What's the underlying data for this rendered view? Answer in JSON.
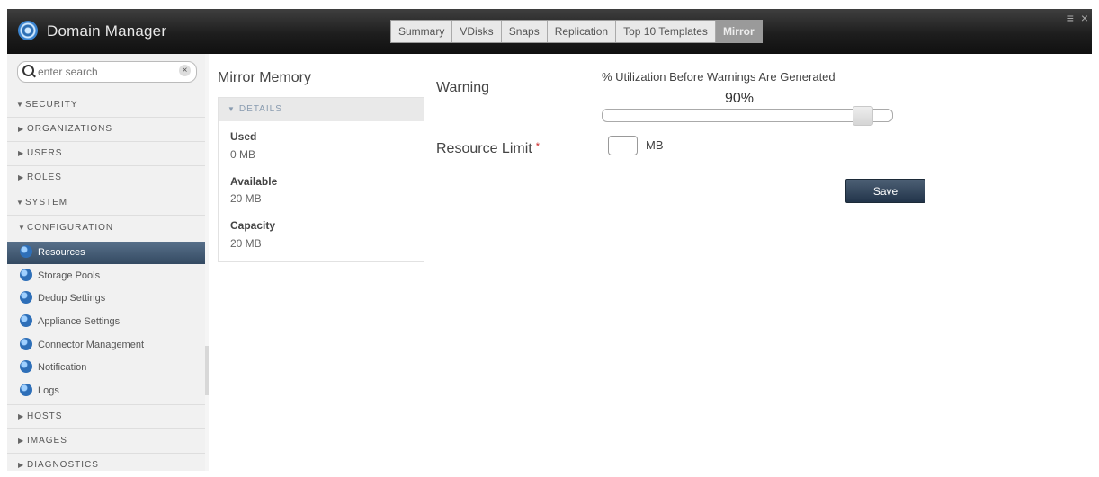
{
  "app": {
    "title": "Domain Manager"
  },
  "tabs": [
    {
      "label": "Summary"
    },
    {
      "label": "VDisks"
    },
    {
      "label": "Snaps"
    },
    {
      "label": "Replication"
    },
    {
      "label": "Top 10 Templates"
    },
    {
      "label": "Mirror",
      "active": true
    }
  ],
  "window_controls": {
    "menu": "≡",
    "close": "×"
  },
  "sidebar": {
    "search_placeholder": "enter search",
    "search_clear": "×",
    "sections": {
      "security": "SECURITY",
      "organizations": "ORGANIZATIONS",
      "users": "USERS",
      "roles": "ROLES",
      "system": "SYSTEM",
      "configuration": "CONFIGURATION",
      "hosts": "HOSTS",
      "images": "IMAGES",
      "diagnostics": "DIAGNOSTICS"
    },
    "config_items": [
      {
        "label": "Resources",
        "active": true
      },
      {
        "label": "Storage Pools"
      },
      {
        "label": "Dedup Settings"
      },
      {
        "label": "Appliance Settings"
      },
      {
        "label": "Connector Management"
      },
      {
        "label": "Notification"
      },
      {
        "label": "Logs"
      }
    ]
  },
  "main": {
    "title": "Mirror Memory",
    "details": {
      "header": "DETAILS",
      "used_label": "Used",
      "used_value": "0 MB",
      "available_label": "Available",
      "available_value": "20 MB",
      "capacity_label": "Capacity",
      "capacity_value": "20 MB"
    },
    "warning_label": "Warning",
    "utilization_title": "% Utilization Before Warnings Are Generated",
    "utilization_value": "90%",
    "utilization_fraction": 0.9,
    "resource_limit_label": "Resource Limit",
    "required_marker": "*",
    "resource_limit_value": "",
    "resource_limit_unit": "MB",
    "save_label": "Save"
  },
  "colors": {
    "accent": "#344a62",
    "required": "#cc2222",
    "titlebar": "#1e1e1e"
  }
}
